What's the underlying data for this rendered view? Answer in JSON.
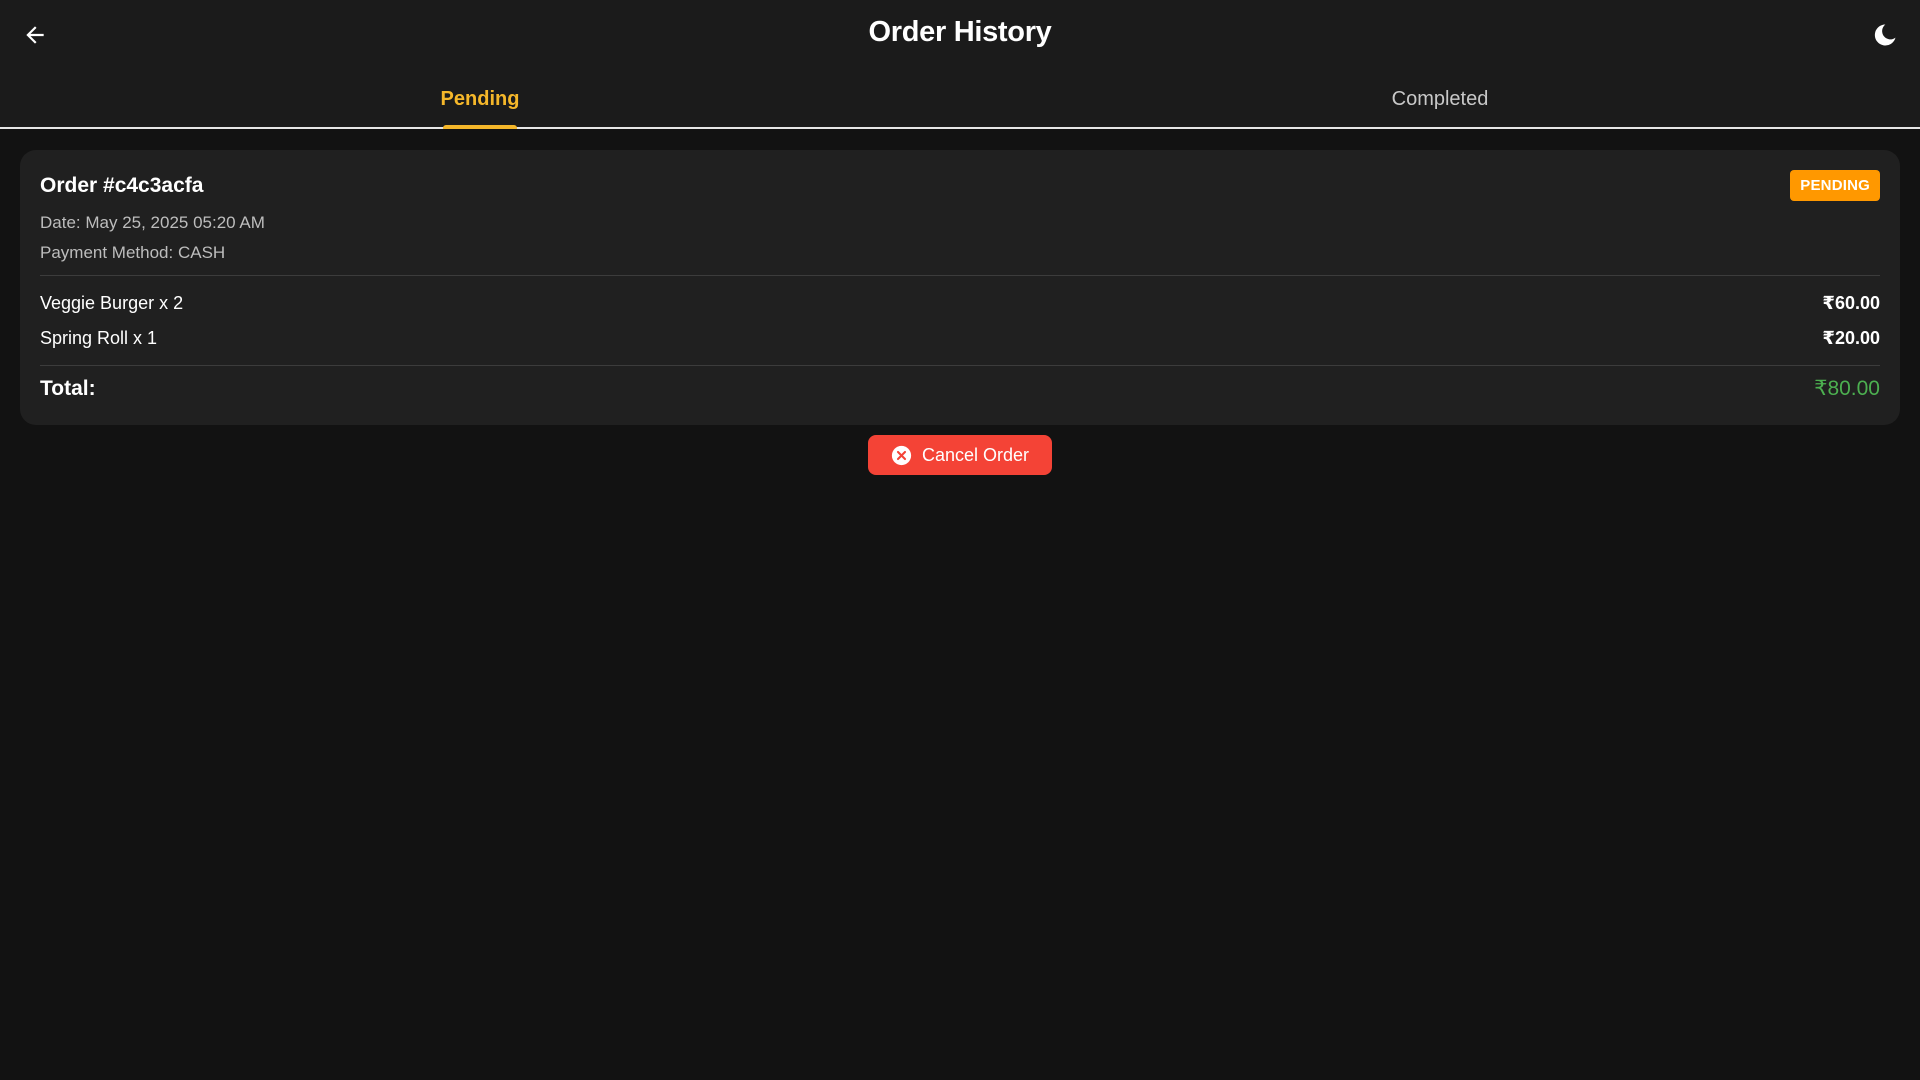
{
  "header": {
    "title": "Order History",
    "back_icon": "arrow-left-icon",
    "theme_icon": "moon-icon"
  },
  "tabs": [
    {
      "label": "Pending",
      "active": true
    },
    {
      "label": "Completed",
      "active": false
    }
  ],
  "order": {
    "id_label": "Order #c4c3acfa",
    "status": "PENDING",
    "date": "Date: May 25, 2025 05:20 AM",
    "payment": "Payment Method: CASH",
    "items": [
      {
        "name": "Veggie Burger x 2",
        "price": "₹60.00"
      },
      {
        "name": "Spring Roll x 1",
        "price": "₹20.00"
      }
    ],
    "total_label": "Total:",
    "total_value": "₹80.00"
  },
  "actions": {
    "cancel_label": "Cancel Order",
    "cancel_icon": "cancel-circle-icon"
  },
  "colors": {
    "accent": "#f5b72a",
    "badge": "#ff9800",
    "total": "#4caf50",
    "cancel": "#f44336",
    "background": "#121212",
    "surface": "#202020"
  }
}
